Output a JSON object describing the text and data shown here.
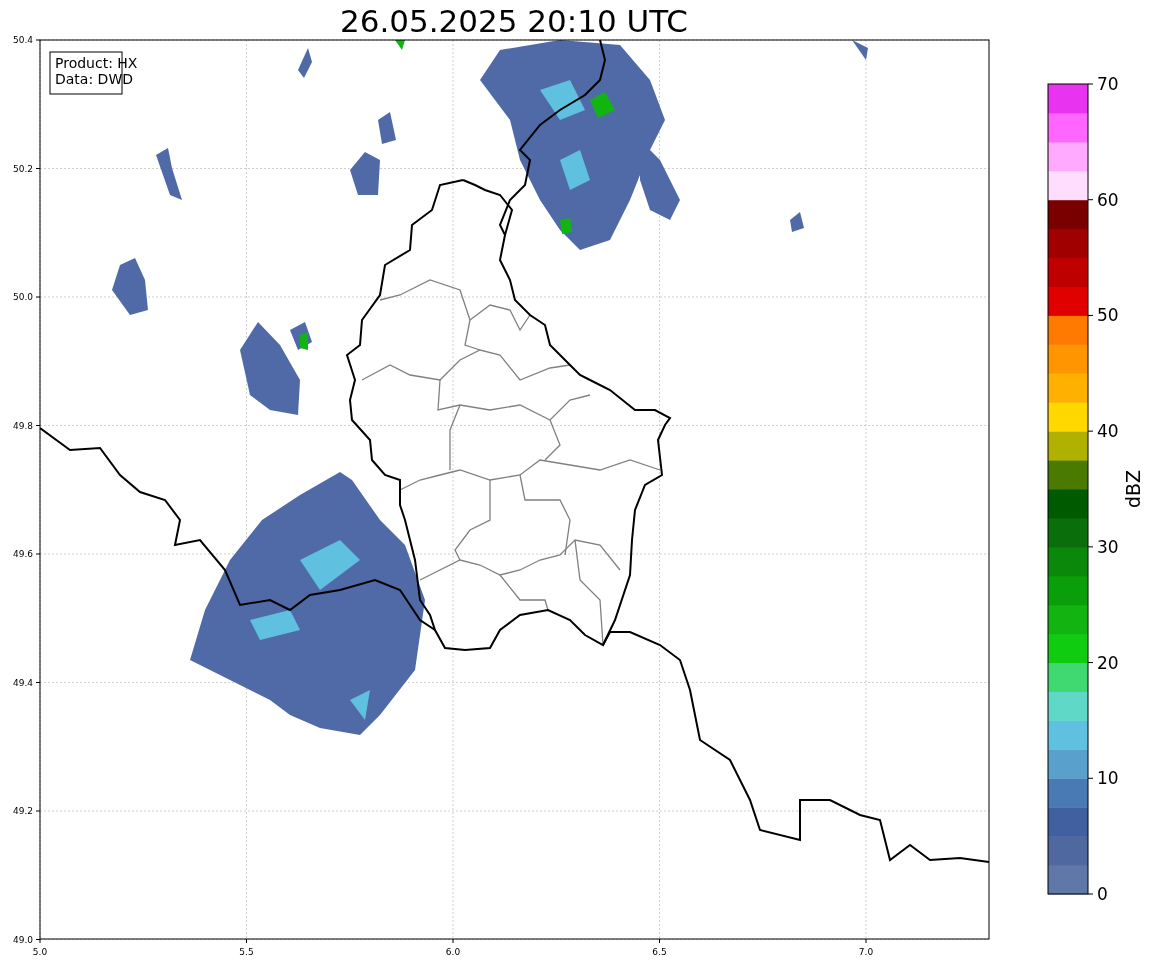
{
  "title": "26.05.2025 20:10 UTC",
  "info_box": [
    "Product: HX",
    "Data: DWD"
  ],
  "x_ticks": [
    "5.0",
    "5.5",
    "6.0",
    "6.5",
    "7.0"
  ],
  "y_ticks": [
    "50.4",
    "50.2",
    "50.0",
    "49.8",
    "49.6",
    "49.4",
    "49.2",
    "49.0"
  ],
  "colorbar": {
    "label": "dBZ",
    "ticks": [
      "70",
      "60",
      "50",
      "40",
      "30",
      "20",
      "10",
      "0"
    ],
    "bands": [
      {
        "color": "#6078a8"
      },
      {
        "color": "#5068a0"
      },
      {
        "color": "#4060a0"
      },
      {
        "color": "#4a7ab4"
      },
      {
        "color": "#5aa0cc"
      },
      {
        "color": "#60c0e0"
      },
      {
        "color": "#60d8c8"
      },
      {
        "color": "#40d870"
      },
      {
        "color": "#10cc10"
      },
      {
        "color": "#12b412"
      },
      {
        "color": "#0a9e0a"
      },
      {
        "color": "#0a880a"
      },
      {
        "color": "#0a6e0a"
      },
      {
        "color": "#005a00"
      },
      {
        "color": "#4a7a00"
      },
      {
        "color": "#b0b000"
      },
      {
        "color": "#ffd800"
      },
      {
        "color": "#ffb000"
      },
      {
        "color": "#ff9500"
      },
      {
        "color": "#ff7a00"
      },
      {
        "color": "#e00000"
      },
      {
        "color": "#c00000"
      },
      {
        "color": "#a00000"
      },
      {
        "color": "#7a0000"
      },
      {
        "color": "#ffddff"
      },
      {
        "color": "#ffaaff"
      },
      {
        "color": "#ff66ff"
      },
      {
        "color": "#e833f0"
      }
    ]
  }
}
